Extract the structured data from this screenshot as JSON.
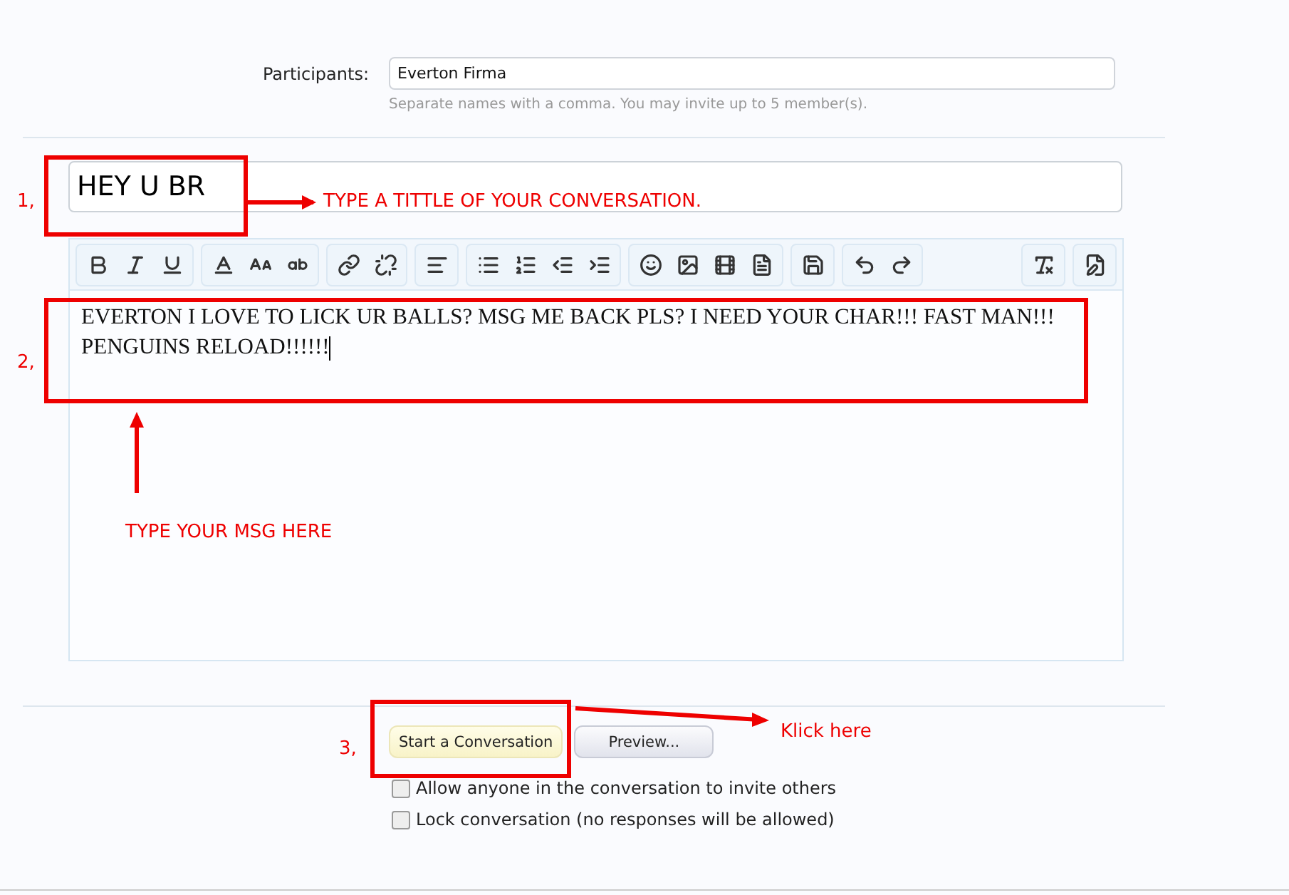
{
  "participants": {
    "label": "Participants:",
    "value": "Everton Firma",
    "hint": "Separate names with a comma. You may invite up to 5 member(s)."
  },
  "title": {
    "value": "HEY U BR"
  },
  "message": {
    "lines": [
      "EVERTON I LOVE TO LICK UR BALLS? MSG ME BACK PLS? I NEED YOUR CHAR!!! FAST MAN!!!",
      "PENGUINS RELOAD!!!!!!"
    ]
  },
  "buttons": [
    {
      "label": "Start a Conversation",
      "kind": "primary"
    },
    {
      "label": "Preview...",
      "kind": "secondary"
    }
  ],
  "options": [
    {
      "label": "Allow anyone in the conversation to invite others",
      "checked": false
    },
    {
      "label": "Lock conversation (no responses will be allowed)",
      "checked": false
    }
  ],
  "annotations": [
    {
      "number": "1,",
      "note": "TYPE A TITTLE OF YOUR CONVERSATION."
    },
    {
      "number": "2,",
      "note": "TYPE YOUR MSG HERE"
    },
    {
      "number": "3,",
      "note": "Klick here"
    }
  ]
}
